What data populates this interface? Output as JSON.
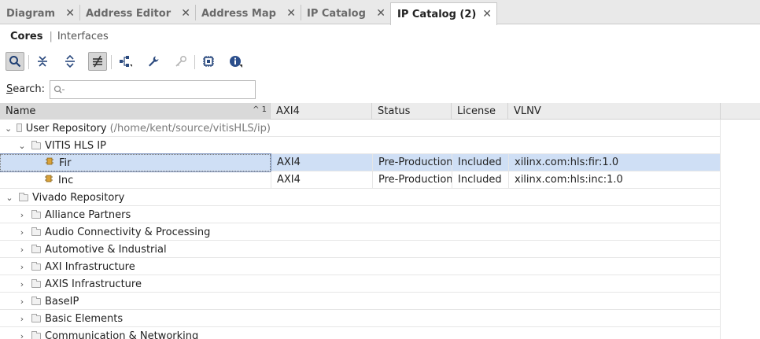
{
  "tabs": [
    {
      "label": "Diagram",
      "active": false
    },
    {
      "label": "Address Editor",
      "active": false
    },
    {
      "label": "Address Map",
      "active": false
    },
    {
      "label": "IP Catalog",
      "active": false
    },
    {
      "label": "IP Catalog (2)",
      "active": true
    }
  ],
  "subtabs": {
    "cores": "Cores",
    "separator": "|",
    "interfaces": "Interfaces"
  },
  "toolbar": {
    "buttons": [
      "search-icon",
      "collapse-all-icon",
      "expand-all-icon",
      "group-by-icon",
      "hierarchy-icon",
      "wrench-icon",
      "key-icon",
      "chip-icon",
      "info-icon"
    ]
  },
  "search": {
    "label": "Search:",
    "placeholder": "Q-"
  },
  "columns": {
    "name": "Name",
    "sort_index": "1",
    "interfaces": "AXI4",
    "status": "Status",
    "license": "License",
    "vlnv": "VLNV"
  },
  "rows": [
    {
      "name": "User Repository",
      "path": "(/home/kent/source/vitisHLS/ip)",
      "interfaces": "",
      "status": "",
      "license": "",
      "vlnv": ""
    },
    {
      "name": "VITIS HLS IP",
      "path": "",
      "interfaces": "",
      "status": "",
      "license": "",
      "vlnv": ""
    },
    {
      "name": "Fir",
      "path": "",
      "interfaces": "AXI4",
      "status": "Pre-Production",
      "license": "Included",
      "vlnv": "xilinx.com:hls:fir:1.0"
    },
    {
      "name": "Inc",
      "path": "",
      "interfaces": "AXI4",
      "status": "Pre-Production",
      "license": "Included",
      "vlnv": "xilinx.com:hls:inc:1.0"
    },
    {
      "name": "Vivado Repository",
      "path": "",
      "interfaces": "",
      "status": "",
      "license": "",
      "vlnv": ""
    },
    {
      "name": "Alliance Partners",
      "path": "",
      "interfaces": "",
      "status": "",
      "license": "",
      "vlnv": ""
    },
    {
      "name": "Audio Connectivity & Processing",
      "path": "",
      "interfaces": "",
      "status": "",
      "license": "",
      "vlnv": ""
    },
    {
      "name": "Automotive & Industrial",
      "path": "",
      "interfaces": "",
      "status": "",
      "license": "",
      "vlnv": ""
    },
    {
      "name": "AXI Infrastructure",
      "path": "",
      "interfaces": "",
      "status": "",
      "license": "",
      "vlnv": ""
    },
    {
      "name": "AXIS Infrastructure",
      "path": "",
      "interfaces": "",
      "status": "",
      "license": "",
      "vlnv": ""
    },
    {
      "name": "BaseIP",
      "path": "",
      "interfaces": "",
      "status": "",
      "license": "",
      "vlnv": ""
    },
    {
      "name": "Basic Elements",
      "path": "",
      "interfaces": "",
      "status": "",
      "license": "",
      "vlnv": ""
    },
    {
      "name": "Communication & Networking",
      "path": "",
      "interfaces": "",
      "status": "",
      "license": "",
      "vlnv": ""
    }
  ],
  "colors": {
    "selection": "#cfdff5",
    "ip_icon": "#d9a23a",
    "info_icon": "#2c4f8c"
  }
}
